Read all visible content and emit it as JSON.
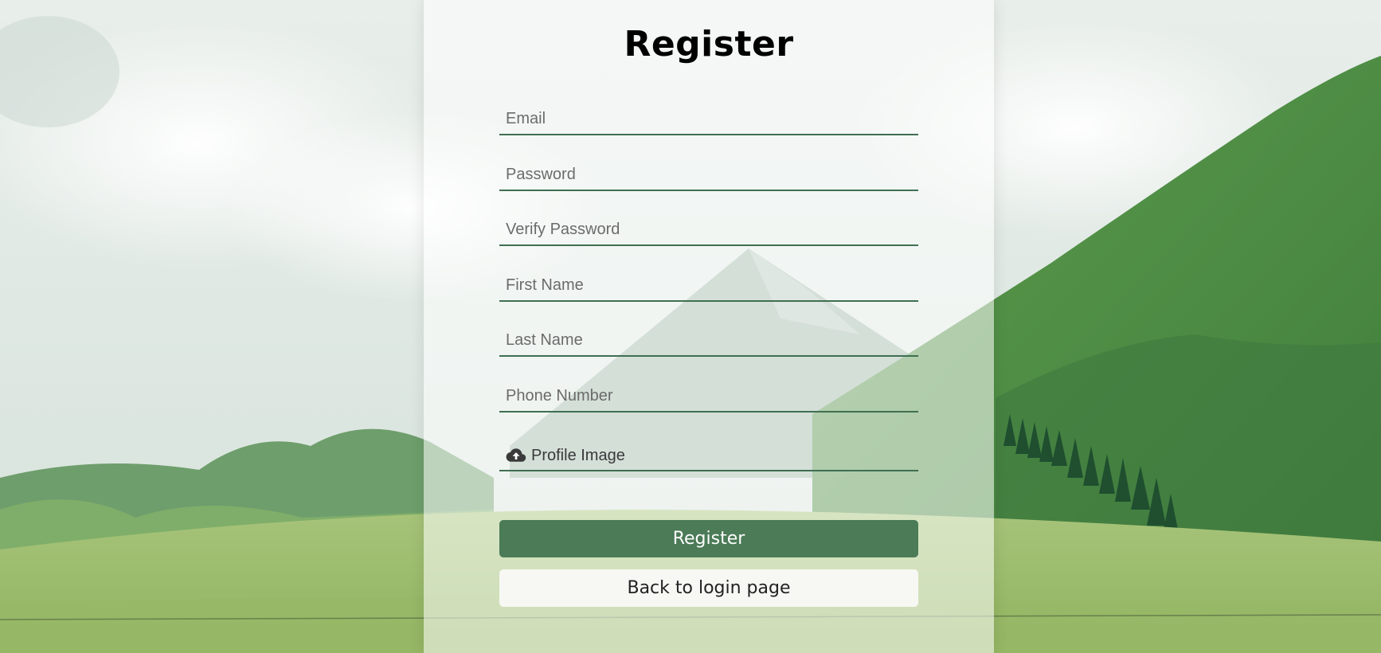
{
  "page": {
    "title": "Register"
  },
  "form": {
    "fields": [
      {
        "name": "email",
        "placeholder": "Email",
        "value": ""
      },
      {
        "name": "password",
        "placeholder": "Password",
        "value": ""
      },
      {
        "name": "verify_password",
        "placeholder": "Verify Password",
        "value": ""
      },
      {
        "name": "first_name",
        "placeholder": "First Name",
        "value": ""
      },
      {
        "name": "last_name",
        "placeholder": "Last Name",
        "value": ""
      },
      {
        "name": "phone_number",
        "placeholder": "Phone Number",
        "value": ""
      }
    ],
    "profile_image": {
      "label": "Profile Image",
      "icon": "cloud-upload-icon"
    },
    "register_label": "Register",
    "back_label": "Back to login page"
  },
  "colors": {
    "accent": "#4b7b57",
    "underline": "#3f6f52"
  }
}
